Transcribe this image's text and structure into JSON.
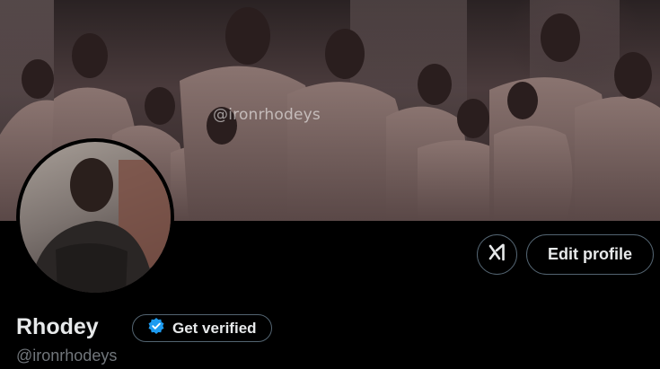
{
  "banner": {
    "watermark": "@ironrhodeys"
  },
  "profile": {
    "display_name": "Rhodey",
    "handle": "@ironrhodeys"
  },
  "actions": {
    "edit_profile_label": "Edit profile",
    "get_verified_label": "Get verified",
    "grok_icon": "grok-icon"
  },
  "colors": {
    "background": "#000000",
    "text_primary": "#e7e9ea",
    "text_secondary": "#71767b",
    "button_border": "#536471",
    "verified_blue": "#1d9bf0"
  }
}
